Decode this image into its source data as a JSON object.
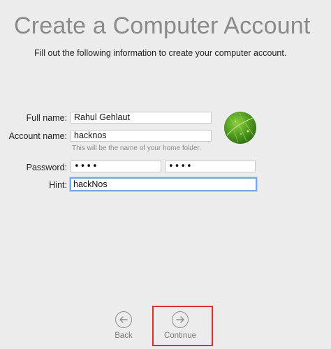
{
  "header": {
    "title": "Create a Computer Account",
    "subtitle": "Fill out the following information to create your computer account."
  },
  "form": {
    "full_name": {
      "label": "Full name:",
      "value": "Rahul Gehlaut"
    },
    "account_name": {
      "label": "Account name:",
      "value": "hacknos",
      "helper": "This will be the name of your home folder."
    },
    "password": {
      "label": "Password:",
      "value": "••••",
      "verify_value": "••••"
    },
    "hint": {
      "label": "Hint:",
      "value": "hackNos"
    }
  },
  "avatar": {
    "icon": "leaf-photo",
    "colors": [
      "#8ccf3d",
      "#2f6b12"
    ]
  },
  "navigation": {
    "back_label": "Back",
    "continue_label": "Continue",
    "back_icon": "arrow-left-icon",
    "continue_icon": "arrow-right-icon"
  },
  "annotation": {
    "highlight_color": "#d93030"
  }
}
